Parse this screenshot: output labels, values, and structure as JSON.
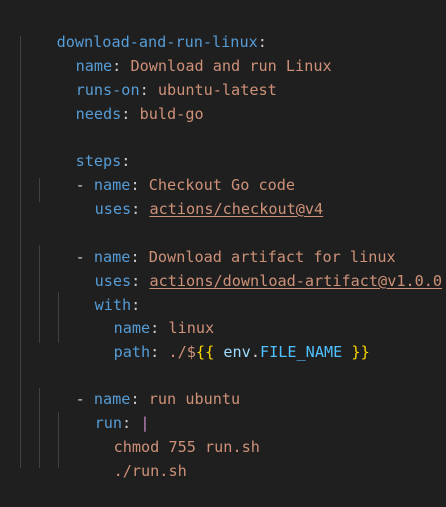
{
  "editor": {
    "job_key": "download-and-run-linux",
    "colon": ":",
    "job": {
      "name_key": "name",
      "name_value": "Download and run Linux",
      "runs_on_key": "runs-on",
      "runs_on_value": "ubuntu-latest",
      "needs_key": "needs",
      "needs_value": "buld-go",
      "steps_key": "steps"
    },
    "steps": [
      {
        "dash": "- ",
        "name_key": "name",
        "name_value": "Checkout Go code",
        "uses_key": "uses",
        "uses_value": "actions/checkout@v4"
      },
      {
        "dash": "- ",
        "name_key": "name",
        "name_value": "Download artifact for linux",
        "uses_key": "uses",
        "uses_value": "actions/download-artifact@v1.0.0",
        "with_key": "with",
        "with_name_key": "name",
        "with_name_value": "linux",
        "with_path_key": "path",
        "with_path_prefix": "./",
        "with_path_dollar": "$",
        "with_path_open": "{{",
        "with_path_env": "env",
        "with_path_dot": ".",
        "with_path_var": "FILE_NAME",
        "with_path_close": "}}"
      },
      {
        "dash": "- ",
        "name_key": "name",
        "name_value": "run ubuntu",
        "run_key": "run",
        "run_pipe": "|",
        "run_lines": [
          "chmod 755 run.sh",
          "./run.sh"
        ]
      }
    ],
    "colors": {
      "background": "#1f1f1f",
      "key": "#569cd6",
      "string": "#ce9178",
      "bracket": "#ffd700",
      "env": "#9cdcfe",
      "constant": "#4fc1ff",
      "pipe": "#c586c0"
    }
  }
}
